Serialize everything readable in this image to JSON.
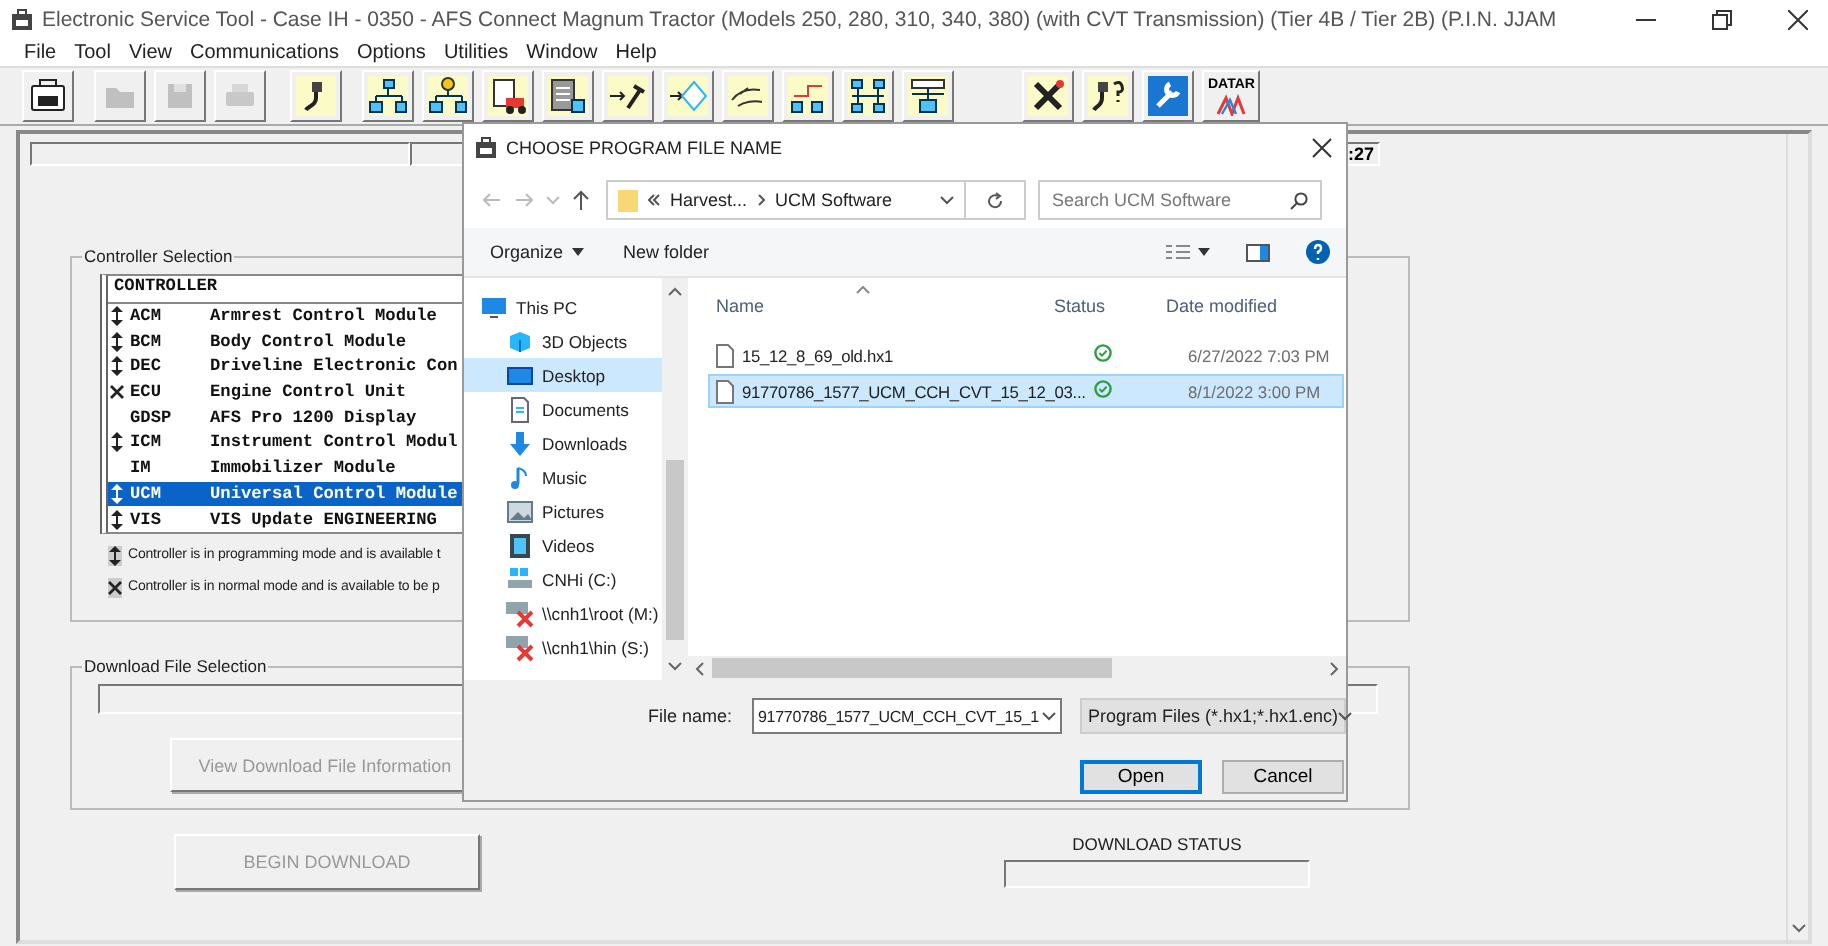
{
  "window": {
    "title": "Electronic Service Tool - Case IH - 0350 - AFS Connect Magnum Tractor (Models 250, 280, 310, 340, 380) (with CVT Transmission) (Tier 4B / Tier 2B) (P.I.N. JJAM"
  },
  "menu": [
    "File",
    "Tool",
    "View",
    "Communications",
    "Options",
    "Utilities",
    "Window",
    "Help"
  ],
  "toolbar": {
    "groups": [
      [
        {
          "disabled": false
        }
      ],
      [
        {
          "disabled": true
        },
        {
          "disabled": true
        },
        {
          "disabled": true
        }
      ],
      [
        {
          "disabled": false
        }
      ],
      [
        {
          "disabled": false
        },
        {
          "disabled": false
        },
        {
          "disabled": false
        },
        {
          "disabled": false
        },
        {
          "disabled": false
        },
        {
          "disabled": false
        },
        {
          "disabled": false
        },
        {
          "disabled": false
        },
        {
          "disabled": false
        },
        {
          "disabled": false
        }
      ],
      [
        {
          "disabled": false
        },
        {
          "disabled": false
        },
        {
          "disabled": false
        },
        {
          "disabled": false,
          "label": "DATAR"
        }
      ]
    ]
  },
  "top_fields": {
    "field_2": ":27"
  },
  "controller_selection": {
    "title": "Controller Selection",
    "header": "CONTROLLER",
    "rows": [
      {
        "kind": "programming",
        "code": "ACM",
        "name": "Armrest Control Module",
        "selected": false
      },
      {
        "kind": "programming",
        "code": "BCM",
        "name": "Body Control Module",
        "selected": false
      },
      {
        "kind": "programming",
        "code": "DEC",
        "name": "Driveline Electronic Con",
        "selected": false
      },
      {
        "kind": "normal",
        "code": "ECU",
        "name": "Engine Control Unit",
        "selected": false
      },
      {
        "kind": "none",
        "code": "GDSP",
        "name": "AFS Pro 1200 Display",
        "selected": false
      },
      {
        "kind": "programming",
        "code": "ICM",
        "name": "Instrument Control Modul",
        "selected": false
      },
      {
        "kind": "none",
        "code": "IM",
        "name": "Immobilizer Module",
        "selected": false
      },
      {
        "kind": "programming",
        "code": "UCM",
        "name": "Universal Control Module",
        "selected": true
      },
      {
        "kind": "programming",
        "code": "VIS",
        "name": "VIS Update ENGINEERING",
        "selected": false
      }
    ],
    "legend": [
      {
        "kind": "programming",
        "text": "Controller is in programming mode and is available t"
      },
      {
        "kind": "normal",
        "text": "Controller is in normal mode and is available to be p"
      }
    ]
  },
  "download_file_selection": {
    "title": "Download File Selection",
    "button": "View Download File Information",
    "disabled": true
  },
  "begin_download": {
    "label": "BEGIN DOWNLOAD",
    "disabled": true
  },
  "download_status": {
    "label": "DOWNLOAD STATUS"
  },
  "dialog": {
    "title": "CHOOSE PROGRAM FILE NAME",
    "breadcrumb": [
      "Harvest...",
      "UCM Software"
    ],
    "search": {
      "placeholder": "Search UCM Software"
    },
    "commands": [
      "Organize",
      "New folder"
    ],
    "nav": [
      {
        "label": "This PC",
        "selected": false,
        "children": [
          {
            "label": "3D Objects",
            "selected": false
          },
          {
            "label": "Desktop",
            "selected": true
          },
          {
            "label": "Documents",
            "selected": false
          },
          {
            "label": "Downloads",
            "selected": false
          },
          {
            "label": "Music",
            "selected": false
          },
          {
            "label": "Pictures",
            "selected": false
          },
          {
            "label": "Videos",
            "selected": false
          },
          {
            "label": "CNHi (C:)",
            "selected": false
          },
          {
            "label": "\\\\cnh1\\root (M:)",
            "selected": false
          },
          {
            "label": "\\\\cnh1\\hin (S:)",
            "selected": false
          }
        ]
      }
    ],
    "columns": [
      "Name",
      "Status",
      "Date modified"
    ],
    "files": [
      {
        "name": "15_12_8_69_old.hx1",
        "date": "6/27/2022 7:03 PM",
        "selected": false
      },
      {
        "name": "91770786_1577_UCM_CCH_CVT_15_12_03...",
        "date": "8/1/2022 3:00 PM",
        "selected": true
      }
    ],
    "file_name_label": "File name:",
    "file_name": "91770786_1577_UCM_CCH_CVT_15_1",
    "file_type": "Program Files (*.hx1;*.hx1.enc)",
    "buttons": [
      "Open",
      "Cancel"
    ]
  }
}
